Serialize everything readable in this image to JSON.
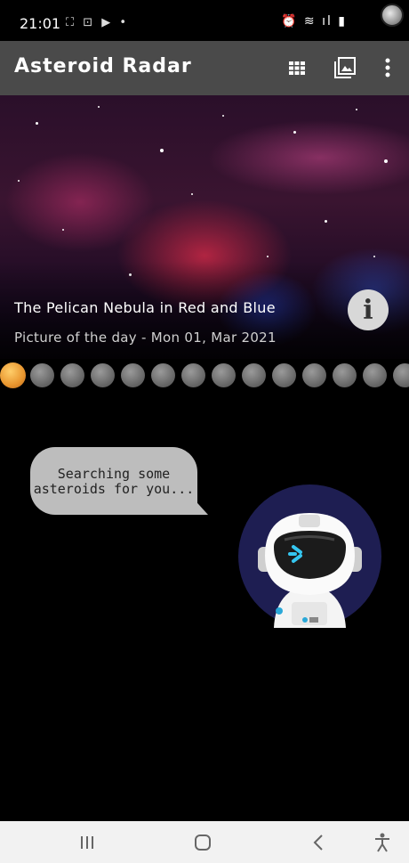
{
  "status_bar": {
    "time": "21:01",
    "left_icons": "⛶ ⊡ ▶ •",
    "right_icons": "⏰ ≋ ıl ▮"
  },
  "toolbar": {
    "title": "Asteroid Radar",
    "grid_icon": "grid-icon",
    "gallery_icon": "gallery-icon",
    "menu_icon": "more-vert-icon"
  },
  "picture_of_day": {
    "title": "The Pelican Nebula in Red and Blue",
    "subtitle": "Picture of the day - Mon 01, Mar 2021",
    "info_label": "i"
  },
  "asteroids": {
    "count": 14,
    "first_color": "#e8952e",
    "rest_color": "#7a7a7a"
  },
  "loading": {
    "message": "Searching some asteroids for you..."
  },
  "nav_bar": {
    "recents_icon": "recents-icon",
    "home_icon": "home-icon",
    "back_icon": "back-icon",
    "accessibility_icon": "accessibility-icon"
  },
  "colors": {
    "toolbar": "#4a4a4a",
    "background": "#000000",
    "bubble": "#bdbdbd",
    "astronaut_circle": "#1e1e52"
  }
}
